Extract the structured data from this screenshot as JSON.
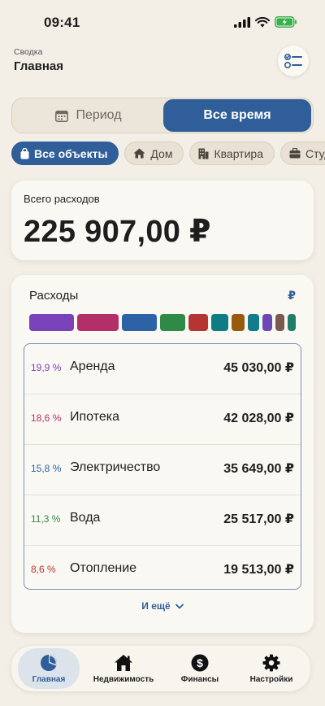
{
  "status": {
    "time": "09:41"
  },
  "header": {
    "subtitle": "Сводка",
    "title": "Главная"
  },
  "segment": {
    "period_label": "Период",
    "all_time_label": "Все время"
  },
  "chips": [
    {
      "label": "Все объекты",
      "icon": "bag-icon",
      "active": true
    },
    {
      "label": "Дом",
      "icon": "house-icon",
      "active": false
    },
    {
      "label": "Квартира",
      "icon": "building-icon",
      "active": false
    },
    {
      "label": "Студи",
      "icon": "briefcase-icon",
      "active": false
    }
  ],
  "total": {
    "label": "Всего расходов",
    "value": "225 907,00 ₽"
  },
  "expenses": {
    "title": "Расходы",
    "currency": "₽",
    "color_segments": [
      {
        "color": "#7a42b8",
        "share": 0.199
      },
      {
        "color": "#b42f68",
        "share": 0.186
      },
      {
        "color": "#2e62a6",
        "share": 0.158
      },
      {
        "color": "#2e8a46",
        "share": 0.113
      },
      {
        "color": "#b53434",
        "share": 0.086
      },
      {
        "color": "#0e7c84",
        "share": 0.075
      },
      {
        "color": "#9a5a0e",
        "share": 0.058
      },
      {
        "color": "#127c8a",
        "share": 0.052
      },
      {
        "color": "#6b48b4",
        "share": 0.045
      },
      {
        "color": "#7a5a50",
        "share": 0.04
      },
      {
        "color": "#1f7e66",
        "share": 0.035
      }
    ],
    "rows": [
      {
        "pct": "19,9 %",
        "name": "Аренда",
        "amount": "45 030,00 ₽",
        "color": "#7a42b8"
      },
      {
        "pct": "18,6 %",
        "name": "Ипотека",
        "amount": "42 028,00 ₽",
        "color": "#b42f68"
      },
      {
        "pct": "15,8 %",
        "name": "Электричество",
        "amount": "35 649,00 ₽",
        "color": "#2e62a6"
      },
      {
        "pct": "11,3 %",
        "name": "Вода",
        "amount": "25 517,00 ₽",
        "color": "#2e8a46"
      },
      {
        "pct": "8,6 %",
        "name": "Отопление",
        "amount": "19 513,00 ₽",
        "color": "#b53434"
      }
    ],
    "more_label": "И ещё"
  },
  "tabs": [
    {
      "label": "Главная",
      "icon": "pie-chart-icon",
      "active": true
    },
    {
      "label": "Недвижимость",
      "icon": "house-icon",
      "active": false
    },
    {
      "label": "Финансы",
      "icon": "dollar-coin-icon",
      "active": false
    },
    {
      "label": "Настройки",
      "icon": "gear-icon",
      "active": false
    }
  ]
}
